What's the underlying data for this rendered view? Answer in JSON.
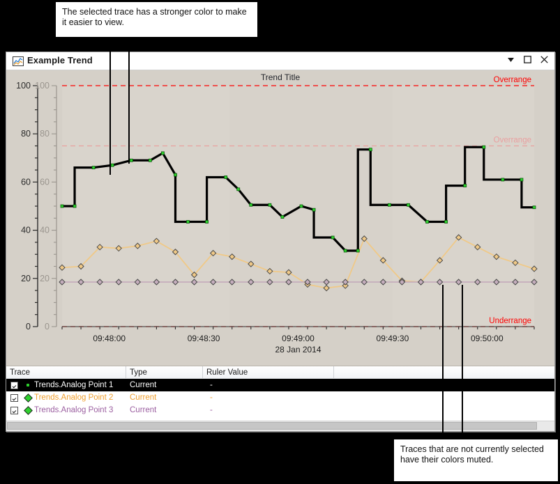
{
  "annotations": {
    "top": "The selected trace has a stronger color to make it easier to view.",
    "bottom": "Traces that are not currently selected have their colors muted."
  },
  "window": {
    "title": "Example Trend",
    "icon": "trend-chart-icon",
    "controls": {
      "menu": "chevron-down-icon",
      "maximize": "maximize-icon",
      "close": "close-icon"
    }
  },
  "colors": {
    "chart_background": "#d5d0c8",
    "plot_background": "#d5d0c8",
    "selected_trace": "#000000",
    "muted_trace_2": "#f0c987",
    "muted_trace_3": "#c5aebd",
    "marker_selected": "#2ed12e",
    "overrange_strong": "#ff0000",
    "overrange_muted": "#e9a0a0",
    "underrange_strong": "#ff0000",
    "axis_strong": "#2b2b2b",
    "axis_muted": "#9a958e",
    "selected_row_bg": "#000000",
    "row2_text": "#f0a030",
    "row3_text": "#9b5fa0"
  },
  "table": {
    "headers": [
      "Trace",
      "Type",
      "Ruler Value",
      ""
    ],
    "rows": [
      {
        "checked": true,
        "marker": "dot",
        "name": "Trends.Analog Point 1",
        "type": "Current",
        "ruler": "-",
        "selected": true
      },
      {
        "checked": true,
        "marker": "diamond",
        "name": "Trends.Analog Point 2",
        "type": "Current",
        "ruler": "-",
        "selected": false
      },
      {
        "checked": true,
        "marker": "diamond",
        "name": "Trends.Analog Point 3",
        "type": "Current",
        "ruler": "-",
        "selected": false
      }
    ]
  },
  "chart_data": {
    "type": "line",
    "title": "Trend Title",
    "xlabel": "28 Jan 2014",
    "ylabel": "",
    "xlim": [
      0,
      150
    ],
    "ylim": [
      0,
      100
    ],
    "grid": false,
    "legend_position": "table-below",
    "x_tick_labels": [
      "09:48:00",
      "09:48:30",
      "09:49:00",
      "09:49:30",
      "09:50:00"
    ],
    "x_tick_values": [
      15,
      45,
      75,
      105,
      135
    ],
    "x_minor_step": 6,
    "axes": [
      {
        "name": "primary",
        "style": "strong",
        "ticks": [
          0,
          20,
          40,
          60,
          80,
          100
        ],
        "minor_step": 5
      },
      {
        "name": "secondary",
        "style": "muted",
        "ticks": [
          0,
          20,
          40,
          60,
          80,
          100
        ],
        "minor_step": 5
      }
    ],
    "limit_lines": [
      {
        "label": "Overrange",
        "value": 100,
        "style": "strong",
        "color": "#ff0000"
      },
      {
        "label": "Overrange",
        "value": 75,
        "style": "muted",
        "color": "#e9a0a0"
      },
      {
        "label": "Underrange",
        "value": 0,
        "style": "strong",
        "color": "#ff0000"
      }
    ],
    "series": [
      {
        "name": "Trends.Analog Point 1",
        "selected": true,
        "color": "#000000",
        "marker_color": "#2ed12e",
        "marker": "dot",
        "step": true,
        "x": [
          0,
          6,
          12,
          18,
          24,
          30,
          36,
          42,
          48,
          54,
          60,
          66,
          72,
          78,
          84,
          90,
          96,
          102,
          108,
          114,
          120,
          126,
          132,
          138,
          144,
          150
        ],
        "y": [
          50,
          66,
          67,
          69,
          69,
          72,
          63,
          43.5,
          43.5,
          62,
          57,
          50.5,
          50.5,
          45.5,
          50,
          48.5,
          37,
          31.5,
          31.5,
          73.5,
          50.5,
          50.5,
          43.5,
          43.5,
          58.5,
          74.5
        ]
      },
      {
        "name": "Trends.Analog Point 2",
        "selected": false,
        "color": "#f0c987",
        "marker_color": "#f0c987",
        "marker": "diamond",
        "step": false,
        "x": [
          0,
          6,
          12,
          18,
          24,
          30,
          36,
          42,
          48,
          54,
          60,
          66,
          72,
          78,
          84,
          90,
          96,
          102,
          108,
          114,
          120,
          126,
          132,
          138,
          144,
          150
        ],
        "y": [
          24.5,
          25,
          33,
          32.5,
          33.5,
          35.5,
          31,
          21.5,
          30.5,
          29,
          26,
          23,
          22.5,
          17.5,
          16,
          17,
          36.5,
          27.5,
          19,
          18.5,
          27.5,
          37,
          33,
          29,
          26.5,
          24
        ]
      },
      {
        "name": "Trends.Analog Point 3",
        "selected": false,
        "color": "#c5aebd",
        "marker_color": "#c5aebd",
        "marker": "diamond",
        "step": false,
        "x": [
          0,
          6,
          12,
          18,
          24,
          30,
          36,
          42,
          48,
          54,
          60,
          66,
          72,
          78,
          84,
          90,
          96,
          102,
          108,
          114,
          120,
          126,
          132,
          138,
          144,
          150
        ],
        "y": [
          18.5,
          18.5,
          18.5,
          18.5,
          18.5,
          18.5,
          18.5,
          18.5,
          18.5,
          18.5,
          18.5,
          18.5,
          18.5,
          18.5,
          18.5,
          18.5,
          18.5,
          18.5,
          18.5,
          18.5,
          18.5,
          18.5,
          18.5,
          18.5,
          18.5,
          18.5
        ]
      }
    ],
    "series_full": {
      "trace1_x": [
        0,
        4,
        10,
        16,
        22,
        28,
        32,
        36,
        40,
        46,
        52,
        56,
        60,
        66,
        70,
        76,
        80,
        86,
        90,
        94,
        98,
        104,
        110,
        116,
        122,
        128,
        134,
        140,
        146,
        150
      ],
      "trace1_y": [
        50,
        50,
        66,
        67,
        69,
        69,
        72,
        63,
        43.5,
        43.5,
        62,
        57,
        50.5,
        50.5,
        45.5,
        50,
        48.5,
        37,
        31.5,
        31.5,
        73.5,
        50.5,
        50.5,
        43.5,
        43.5,
        58.5,
        74.5,
        61,
        61,
        49.5
      ]
    }
  }
}
